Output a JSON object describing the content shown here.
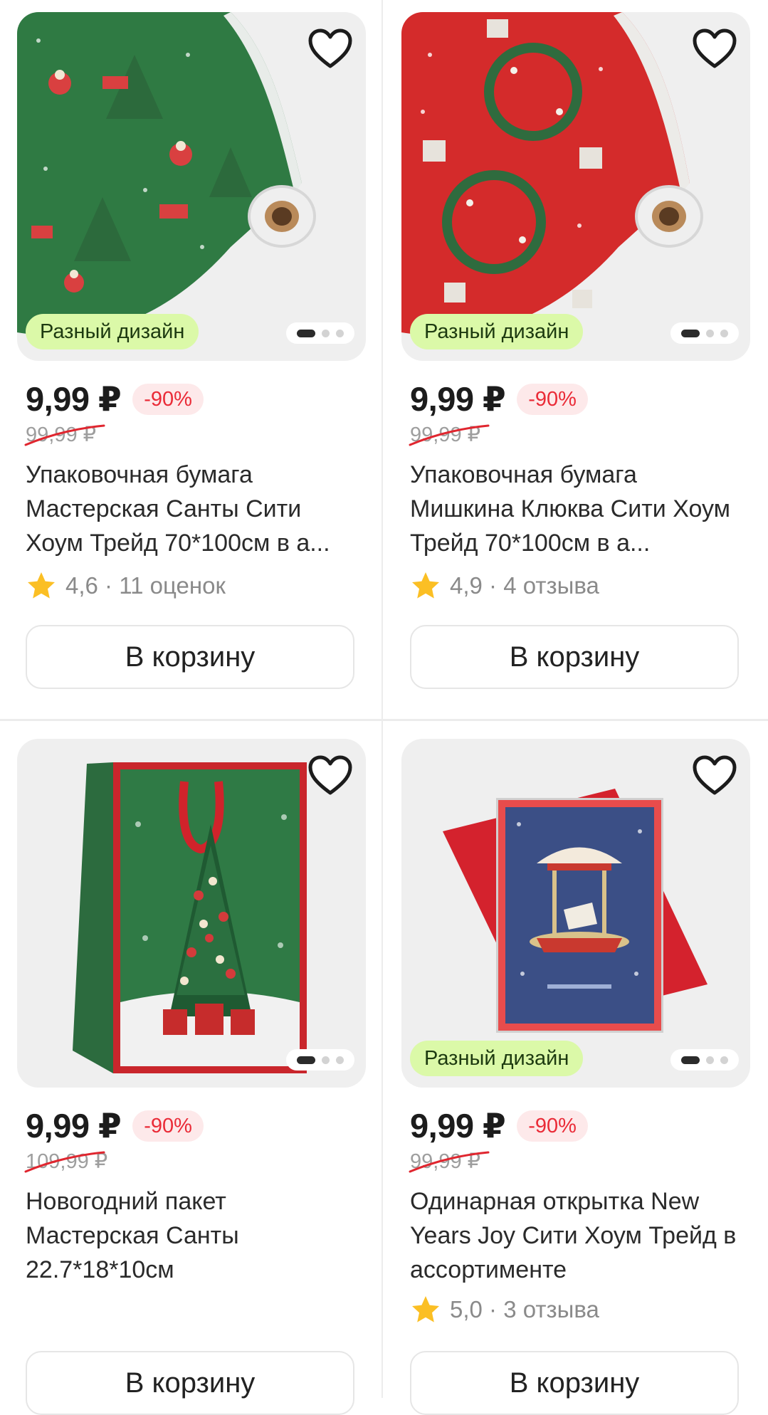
{
  "products": [
    {
      "badge": "Разный дизайн",
      "price": "9,99 ₽",
      "discount": "-90%",
      "old_price": "99,99 ₽",
      "title": "Упаковочная бумага Мастерская Санты Сити Хоум Трейд 70*100см в а...",
      "rating": "4,6",
      "reviews": "· 11 оценок",
      "cart_label": "В корзину",
      "gallery_dots": 3,
      "active_dot": 1
    },
    {
      "badge": "Разный дизайн",
      "price": "9,99 ₽",
      "discount": "-90%",
      "old_price": "99,99 ₽",
      "title": "Упаковочная бумага Мишкина Клюква Сити Хоум Трейд 70*100см в а...",
      "rating": "4,9",
      "reviews": "· 4 отзыва",
      "cart_label": "В корзину",
      "gallery_dots": 3,
      "active_dot": 1
    },
    {
      "price": "9,99 ₽",
      "discount": "-90%",
      "old_price": "109,99 ₽",
      "title": "Новогодний пакет Мастерская Санты 22.7*18*10см",
      "cart_label": "В корзину",
      "gallery_dots": 3,
      "active_dot": 1
    },
    {
      "badge": "Разный дизайн",
      "price": "9,99 ₽",
      "discount": "-90%",
      "old_price": "99,99 ₽",
      "title": "Одинарная открытка New Years Joy Сити Хоум Трейд в ассортименте",
      "rating": "5,0",
      "reviews": "· 3 отзыва",
      "cart_label": "В корзину",
      "gallery_dots": 3,
      "active_dot": 1
    }
  ],
  "icons": {
    "favorite": "heart-outline-icon",
    "rating": "star-icon"
  },
  "colors": {
    "badge_bg": "#dbf9a8",
    "discount_text": "#ea2b37",
    "discount_bg": "#fde9ea",
    "star": "#fbbf24",
    "strike": "#e0262f"
  }
}
